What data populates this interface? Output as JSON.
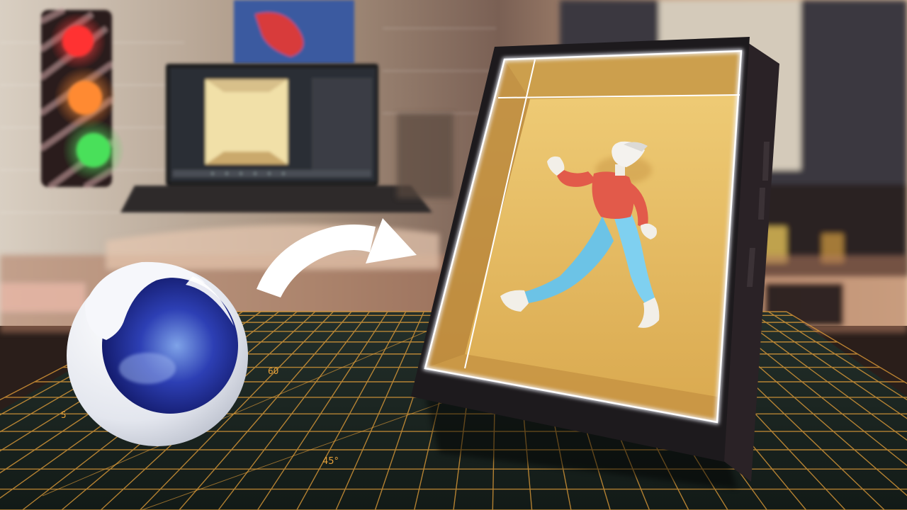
{
  "scene": {
    "description_tags": [
      "cinema-4d-logo",
      "arrow",
      "holographic-display-frame",
      "cutting-mat"
    ],
    "colors": {
      "wall": "#c9b9a6",
      "wall_warm": "#e8c6a0",
      "mat": "#1d2a26",
      "mat_lines": "#e8a23a",
      "frame": "#1e1b1e",
      "frame_inner": "#e6b65c",
      "frame_glow": "#f4f6ff",
      "logo_blue": "#2a3aa8",
      "logo_white": "#f2f4f8",
      "arrow": "#ffffff",
      "figure_shirt": "#e25a4a",
      "figure_pants": "#6cc3e6"
    }
  },
  "mat": {
    "marks": [
      "60",
      "5",
      "45°"
    ]
  },
  "laptop": {
    "screen_color": "#2c2f35"
  },
  "traffic_light": {
    "lights": [
      "#ff2a2a",
      "#ff7a20",
      "#38d04a"
    ]
  }
}
